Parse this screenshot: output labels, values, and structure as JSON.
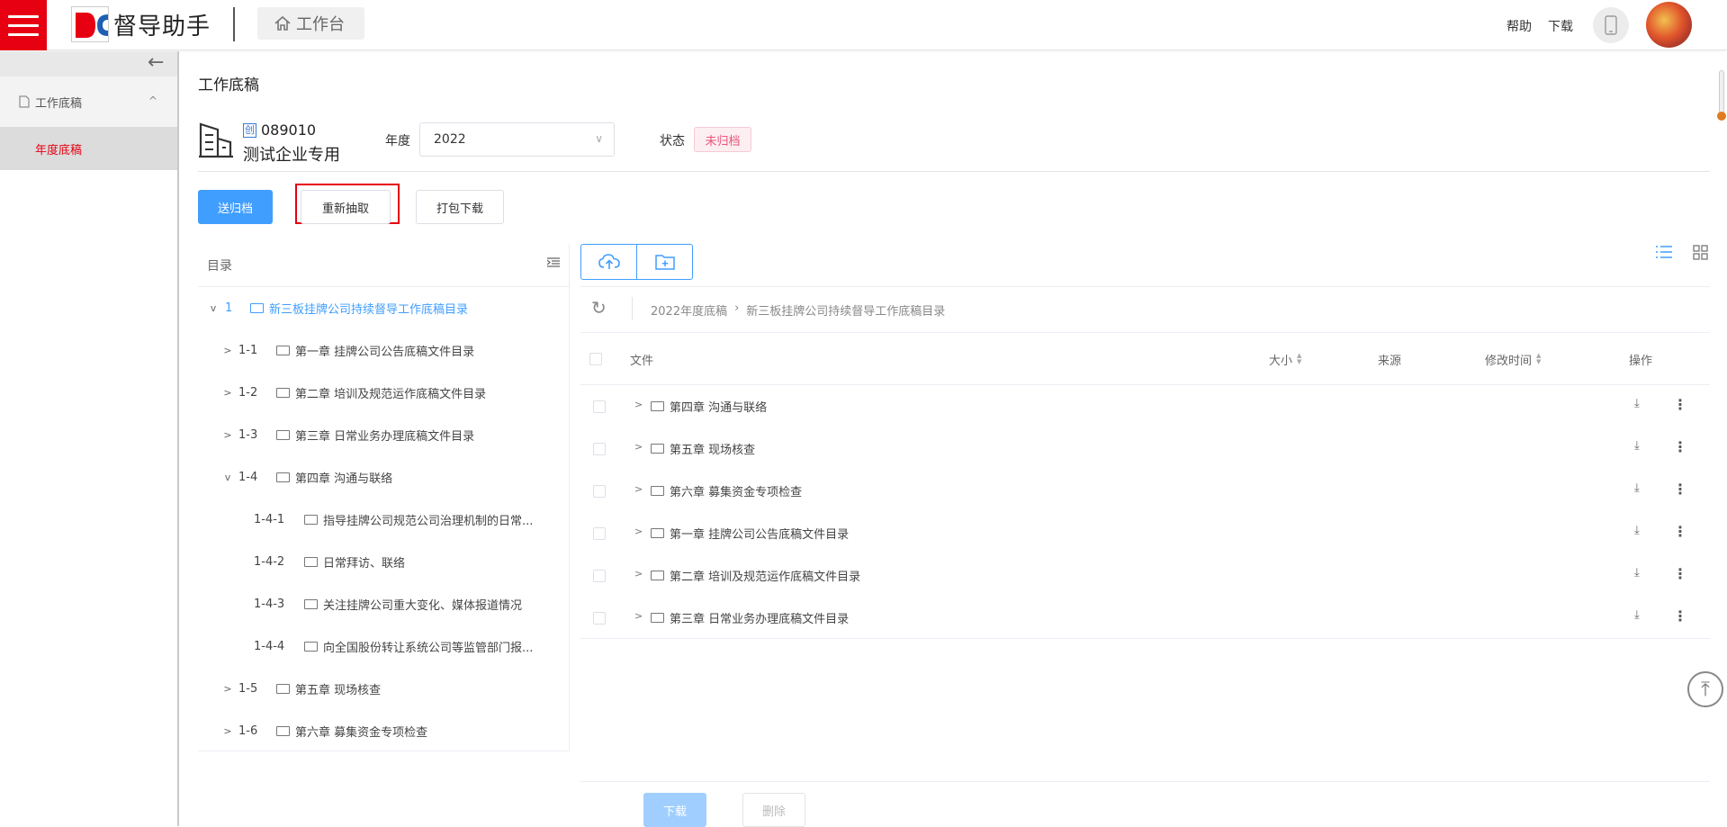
{
  "header": {
    "brand": "督导助手",
    "workbench": "工作台",
    "help": "帮助",
    "download": "下载"
  },
  "sidebar": {
    "menu": "工作底稿",
    "sub": "年度底稿"
  },
  "page": {
    "title": "工作底稿",
    "tag": "创",
    "company_code": "089010",
    "company_name": "测试企业专用",
    "year_label": "年度",
    "year_value": "2022",
    "status_label": "状态",
    "status_value": "未归档"
  },
  "actions": {
    "archive": "送归档",
    "reextract": "重新抽取",
    "pack": "打包下载"
  },
  "tree": {
    "title": "目录",
    "nodes": [
      {
        "num": "1",
        "label": "新三板挂牌公司持续督导工作底稿目录",
        "toggle": "v"
      },
      {
        "num": "1-1",
        "label": "第一章 挂牌公司公告底稿文件目录",
        "toggle": ">"
      },
      {
        "num": "1-2",
        "label": "第二章 培训及规范运作底稿文件目录",
        "toggle": ">"
      },
      {
        "num": "1-3",
        "label": "第三章 日常业务办理底稿文件目录",
        "toggle": ">"
      },
      {
        "num": "1-4",
        "label": "第四章 沟通与联络",
        "toggle": "v"
      },
      {
        "num": "1-4-1",
        "label": "指导挂牌公司规范公司治理机制的日常...",
        "toggle": ""
      },
      {
        "num": "1-4-2",
        "label": "日常拜访、联络",
        "toggle": ""
      },
      {
        "num": "1-4-3",
        "label": "关注挂牌公司重大变化、媒体报道情况",
        "toggle": ""
      },
      {
        "num": "1-4-4",
        "label": "向全国股份转让系统公司等监管部门报...",
        "toggle": ""
      },
      {
        "num": "1-5",
        "label": "第五章 现场核查",
        "toggle": ">"
      },
      {
        "num": "1-6",
        "label": "第六章 募集资金专项检查",
        "toggle": ">"
      }
    ]
  },
  "breadcrumb": {
    "items": [
      "2022年度底稿",
      "新三板挂牌公司持续督导工作底稿目录"
    ]
  },
  "table": {
    "headers": {
      "file": "文件",
      "size": "大小",
      "source": "来源",
      "modified": "修改时间",
      "ops": "操作"
    },
    "rows": [
      {
        "name": "第四章 沟通与联络"
      },
      {
        "name": "第五章 现场核查"
      },
      {
        "name": "第六章 募集资金专项检查"
      },
      {
        "name": "第一章 挂牌公司公告底稿文件目录"
      },
      {
        "name": "第二章 培训及规范运作底稿文件目录"
      },
      {
        "name": "第三章 日常业务办理底稿文件目录"
      }
    ]
  },
  "footer": {
    "download": "下载",
    "delete": "删除"
  },
  "colors": {
    "accent": "#409eff",
    "brand_red": "#e60012",
    "status_pink": "#e8557a"
  },
  "icons": [
    "menu-icon",
    "home-icon",
    "phone-icon",
    "arrow-left-icon",
    "document-icon",
    "building-icon",
    "upload-cloud-icon",
    "new-folder-icon",
    "list-view-icon",
    "grid-view-icon",
    "refresh-icon",
    "folder-icon",
    "download-icon",
    "more-icon",
    "back-to-top-icon"
  ]
}
